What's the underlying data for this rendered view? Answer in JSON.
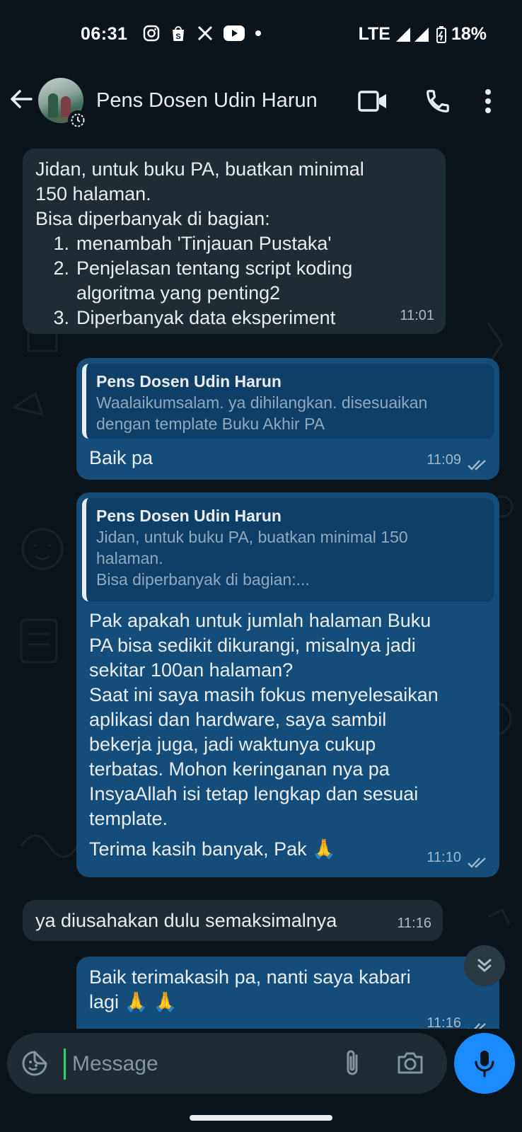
{
  "status_bar": {
    "time": "06:31",
    "network": "LTE",
    "battery": "18%"
  },
  "header": {
    "contact_name": "Pens Dosen Udin Harun"
  },
  "messages": [
    {
      "direction": "in",
      "intro_lines": [
        "Jidan, untuk buku PA, buatkan minimal",
        "150 halaman.",
        "Bisa diperbanyak di bagian:"
      ],
      "list": [
        {
          "num": "1.",
          "text": "menambah 'Tinjauan Pustaka'"
        },
        {
          "num": "2.",
          "text": "Penjelasan tentang script koding"
        },
        {
          "num": "",
          "text": "algoritma yang penting2"
        },
        {
          "num": "3.",
          "text": "Diperbanyak data eksperiment"
        }
      ],
      "time": "11:01"
    },
    {
      "direction": "out",
      "quote": {
        "name": "Pens Dosen Udin Harun",
        "text": "Waalaikumsalam. ya dihilangkan. disesuaikan dengan template Buku Akhir PA"
      },
      "text": "Baik pa",
      "time": "11:09",
      "status": "read"
    },
    {
      "direction": "out",
      "quote": {
        "name": "Pens Dosen Udin Harun",
        "text_lines": [
          "Jidan, untuk buku PA, buatkan minimal 150",
          "halaman.",
          "Bisa diperbanyak di bagian:..."
        ]
      },
      "text_lines": [
        "Pak apakah untuk jumlah halaman Buku",
        "PA bisa sedikit dikurangi, misalnya jadi",
        "sekitar 100an halaman?",
        "Saat ini saya masih fokus menyelesaikan",
        "aplikasi dan hardware, saya sambil",
        "bekerja juga, jadi waktunya cukup",
        "terbatas. Mohon keringanan nya pa",
        "InsyaAllah isi tetap lengkap dan sesuai",
        "template."
      ],
      "closing": "Terima kasih banyak, Pak 🙏",
      "time": "11:10",
      "status": "read"
    },
    {
      "direction": "in",
      "text": "ya diusahakan dulu semaksimalnya",
      "time": "11:16"
    },
    {
      "direction": "out",
      "text_lines": [
        "Baik terimakasih pa, nanti saya kabari",
        "lagi 🙏 🙏"
      ],
      "time": "11:16",
      "status": "read"
    }
  ],
  "composer": {
    "placeholder": "Message"
  },
  "icons": {
    "back": "back-arrow-icon",
    "video": "video-call-icon",
    "call": "phone-icon",
    "more": "more-vert-icon",
    "emoji": "sticker-icon",
    "attach": "paperclip-icon",
    "camera": "camera-icon",
    "mic": "mic-icon",
    "scroll": "double-chevron-down-icon"
  },
  "colors": {
    "background": "#0b141a",
    "incoming_bubble": "#202c33",
    "outgoing_bubble": "#144d7a",
    "mic_button": "#1a8cff",
    "cursor": "#25d366"
  }
}
